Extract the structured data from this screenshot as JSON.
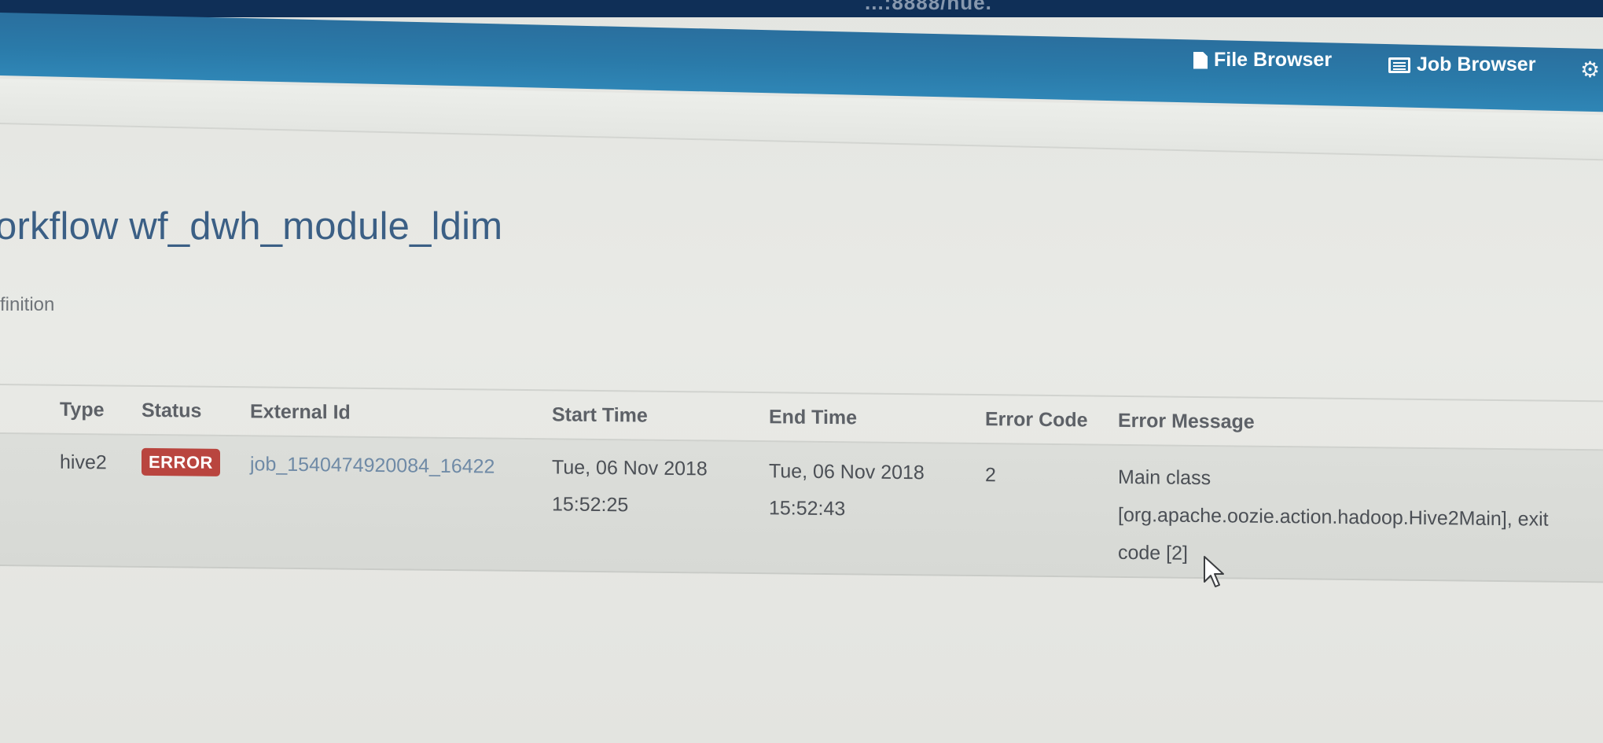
{
  "browser": {
    "url_fragment": "...:8888/hue."
  },
  "navbar": {
    "file_browser": "File Browser",
    "job_browser": "Job Browser",
    "gear_icon": "gear-icon"
  },
  "page": {
    "title": "orkflow wf_dwh_module_ldim",
    "tab_definition": "finition"
  },
  "table": {
    "headers": {
      "type": "Type",
      "status": "Status",
      "external_id": "External Id",
      "start_time": "Start Time",
      "end_time": "End Time",
      "error_code": "Error Code",
      "error_message": "Error Message"
    },
    "rows": [
      {
        "type": "hive2",
        "status": "ERROR",
        "external_id": "job_1540474920084_16422",
        "start_date": "Tue, 06 Nov 2018",
        "start_clock": "15:52:25",
        "end_date": "Tue, 06 Nov 2018",
        "end_clock": "15:52:43",
        "error_code": "2",
        "error_message_line1": "Main class",
        "error_message_line2": "[org.apache.oozie.action.hadoop.Hive2Main], exit",
        "error_message_line3": "code [2]"
      }
    ]
  },
  "colors": {
    "navbar": "#2a7aa9",
    "error_badge": "#b9453f",
    "title": "#3b5f85",
    "link": "#6f8aa6"
  }
}
